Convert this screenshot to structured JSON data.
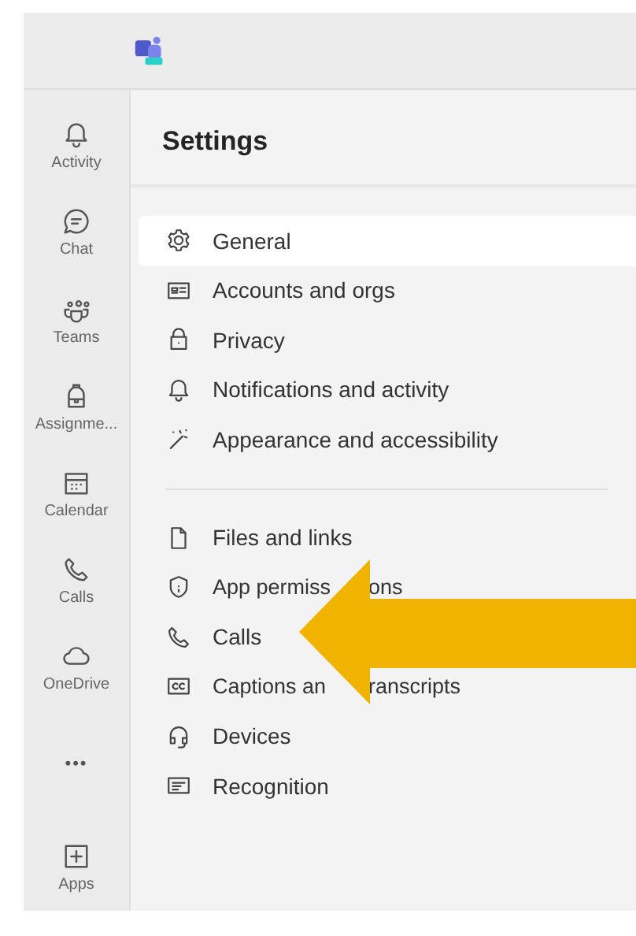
{
  "sidebar": {
    "items": [
      {
        "label": "Activity"
      },
      {
        "label": "Chat"
      },
      {
        "label": "Teams"
      },
      {
        "label": "Assignme..."
      },
      {
        "label": "Calendar"
      },
      {
        "label": "Calls"
      },
      {
        "label": "OneDrive"
      },
      {
        "label": "•••",
        "kind": "more"
      },
      {
        "label": "Apps"
      }
    ]
  },
  "settings": {
    "title": "Settings",
    "groups": [
      [
        {
          "label": "General",
          "selected": true
        },
        {
          "label": "Accounts and orgs",
          "selected": false
        },
        {
          "label": "Privacy",
          "selected": false
        },
        {
          "label": "Notifications and activity",
          "selected": false
        },
        {
          "label": "Appearance and accessibility",
          "selected": false
        }
      ],
      [
        {
          "label": "Files and links",
          "selected": false
        },
        {
          "label": "App permiss",
          "label_tail": "ons",
          "selected": false
        },
        {
          "label": "Calls",
          "selected": false
        },
        {
          "label": "Captions an",
          "label_tail": "ranscripts",
          "selected": false
        },
        {
          "label": "Devices",
          "selected": false
        },
        {
          "label": "Recognition",
          "selected": false
        }
      ]
    ]
  }
}
